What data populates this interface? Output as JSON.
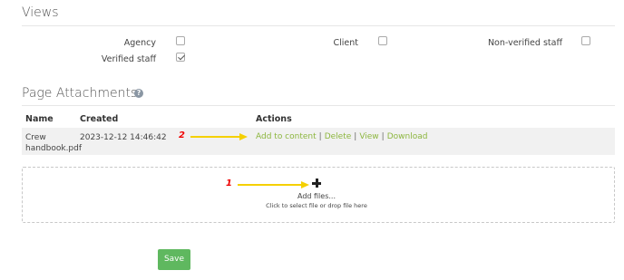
{
  "views": {
    "title": "Views",
    "options": [
      {
        "label": "Agency",
        "checked": false
      },
      {
        "label": "Client",
        "checked": false
      },
      {
        "label": "Non-verified staff",
        "checked": false
      },
      {
        "label": "Verified staff",
        "checked": true
      }
    ]
  },
  "attachments": {
    "title": "Page Attachments",
    "help_icon": "question-circle-icon",
    "columns": {
      "name": "Name",
      "created": "Created",
      "actions": "Actions"
    },
    "rows": [
      {
        "name": "Crew handbook.pdf",
        "created": "2023-12-12 14:46:42",
        "actions": [
          "Add to content",
          "Delete",
          "View",
          "Download"
        ]
      }
    ],
    "dropzone": {
      "icon": "plus-icon",
      "title": "Add files...",
      "subtitle": "Click to select file or drop file here"
    }
  },
  "save_label": "Save",
  "callouts": [
    {
      "number": "1",
      "color": "#ff0000",
      "arrow_color": "#f5d000"
    },
    {
      "number": "2",
      "color": "#ff0000",
      "arrow_color": "#f5d000"
    }
  ],
  "colors": {
    "link": "#8db63f",
    "save_button": "#5fb85f",
    "row_background": "#f1f1f1"
  }
}
